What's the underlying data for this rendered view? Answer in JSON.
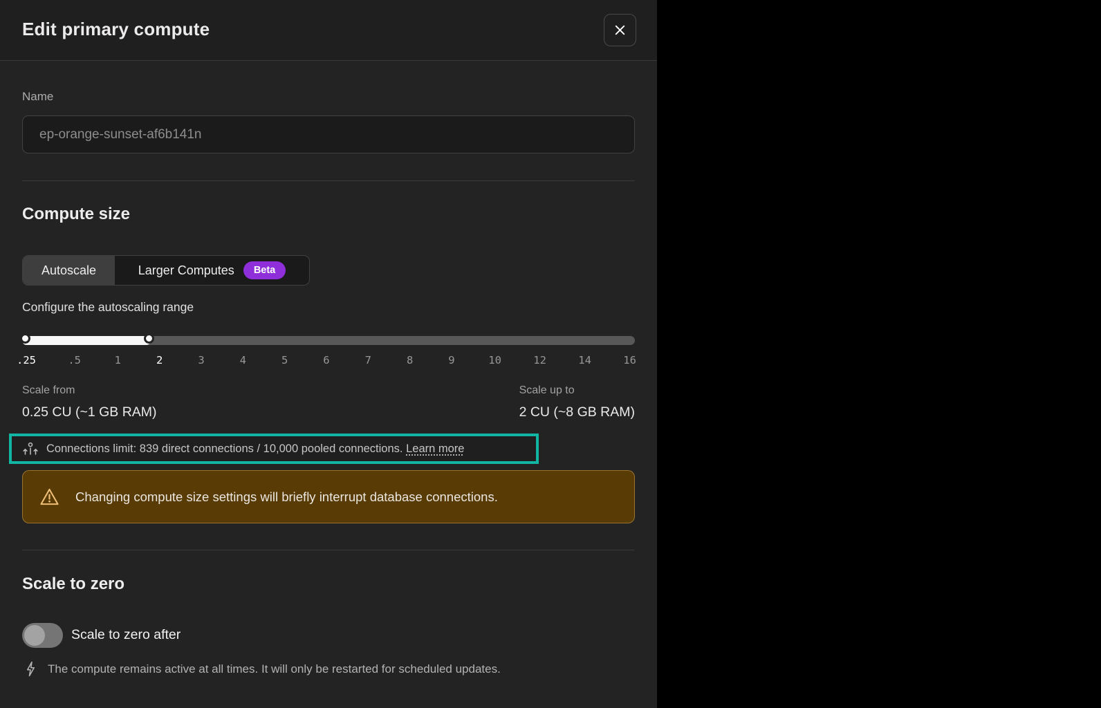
{
  "modal": {
    "title": "Edit primary compute"
  },
  "name_section": {
    "label": "Name",
    "input_value": "ep-orange-sunset-af6b141n"
  },
  "compute_size": {
    "heading": "Compute size",
    "tabs": [
      {
        "label": "Autoscale",
        "selected": true
      },
      {
        "label": "Larger Computes",
        "selected": false,
        "badge": "Beta"
      }
    ],
    "slider_label": "Configure the autoscaling range",
    "ticks": [
      ".25",
      ".5",
      "1",
      "2",
      "3",
      "4",
      "5",
      "6",
      "7",
      "8",
      "9",
      "10",
      "12",
      "14",
      "16"
    ],
    "slider_selected_min": ".25",
    "slider_selected_max": "2",
    "scale_from": {
      "label": "Scale from",
      "value": "0.25 CU (~1 GB RAM)"
    },
    "scale_up_to": {
      "label": "Scale up to",
      "value": "2 CU (~8 GB RAM)"
    },
    "connections_note": {
      "text": "Connections limit: 839 direct connections / 10,000 pooled connections.",
      "link": "Learn more"
    },
    "warning": "Changing compute size settings will briefly interrupt database connections."
  },
  "scale_to_zero": {
    "heading": "Scale to zero",
    "toggle_label": "Scale to zero after",
    "toggle_state": "off",
    "note": "The compute remains active at all times. It will only be restarted for scheduled updates."
  },
  "colors": {
    "highlight_annotation": "#12b5a4",
    "beta_badge": "#8f2fd9",
    "warning_bg": "#583b05",
    "warning_icon": "#f1c078",
    "modal_bg": "#232323"
  }
}
